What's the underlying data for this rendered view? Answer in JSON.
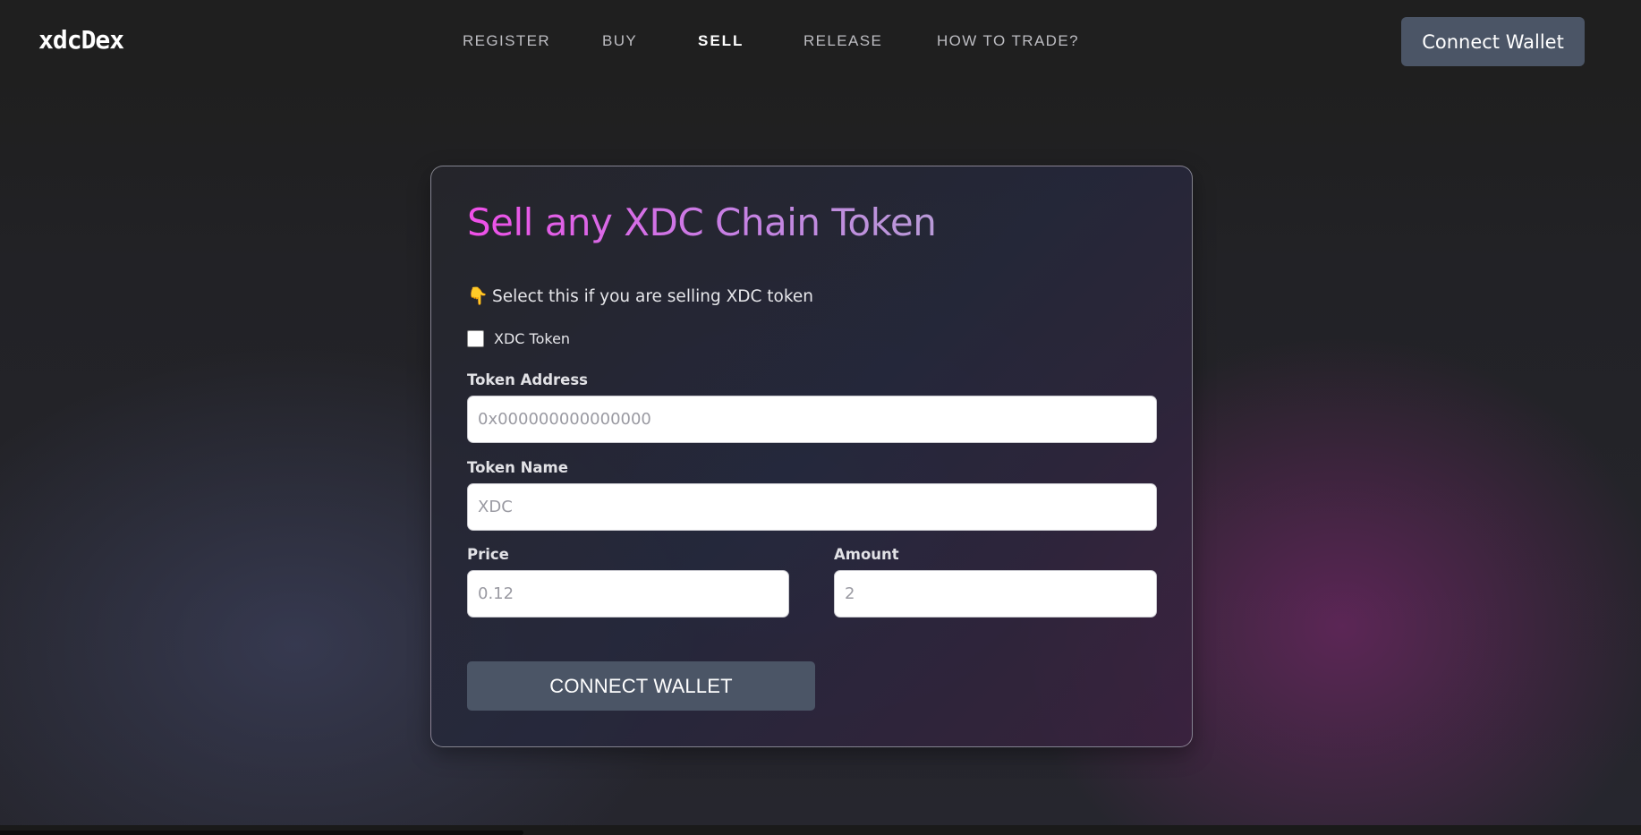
{
  "app": {
    "logo": "xdcDex"
  },
  "nav": {
    "items": [
      {
        "label": "REGISTER",
        "active": false
      },
      {
        "label": "BUY",
        "active": false
      },
      {
        "label": "SELL",
        "active": true
      },
      {
        "label": "RELEASE",
        "active": false
      },
      {
        "label": "HOW TO TRADE?",
        "active": false
      }
    ],
    "connect_label": "Connect Wallet"
  },
  "form": {
    "title": "Sell any XDC Chain Token",
    "hint_icon": "hand-pointing-down-icon",
    "hint_emoji": "👇",
    "hint": "Select this if you are selling XDC token",
    "checkbox": {
      "label": "XDC Token",
      "checked": false
    },
    "token_address": {
      "label": "Token Address",
      "placeholder": "0x000000000000000",
      "value": ""
    },
    "token_name": {
      "label": "Token Name",
      "placeholder": "XDC",
      "value": ""
    },
    "price": {
      "label": "Price",
      "placeholder": "0.12",
      "value": ""
    },
    "amount": {
      "label": "Amount",
      "placeholder": "2",
      "value": ""
    },
    "submit_label": "CONNECT WALLET"
  },
  "colors": {
    "button": "#4b5566",
    "title_gradient_start": "#ef4fe8",
    "title_gradient_end": "#b99ad8",
    "active_nav": "#ffffff"
  }
}
